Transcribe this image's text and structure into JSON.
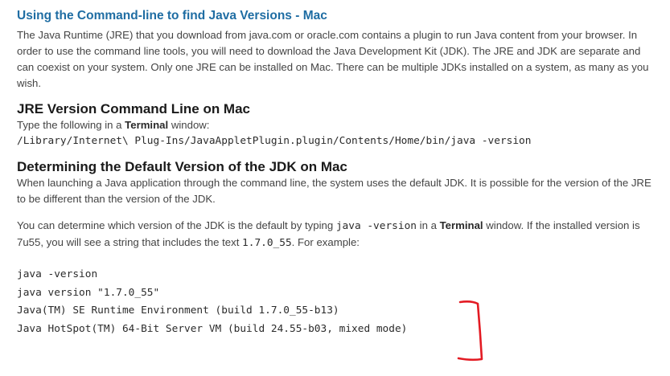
{
  "section": {
    "title": "Using the Command-line to find Java Versions - Mac",
    "intro": "The Java Runtime (JRE) that you download from java.com or oracle.com contains a plugin to run Java content from your browser. In order to use the command line tools, you will need to download the Java Development Kit (JDK). The JRE and JDK are separate and can coexist on your system. Only one JRE can be installed on Mac. There can be multiple JDKs installed on a system, as many as you wish."
  },
  "jre": {
    "heading": "JRE Version Command Line on Mac",
    "type_prefix": "Type the following in a ",
    "terminal_word": "Terminal",
    "type_suffix": " window:",
    "command": "/Library/Internet\\ Plug-Ins/JavaAppletPlugin.plugin/Contents/Home/bin/java -version"
  },
  "jdk": {
    "heading": "Determining the Default Version of the JDK on Mac",
    "para1": "When launching a Java application through the command line, the system uses the default JDK. It is possible for the version of the JRE to be different than the version of the JDK.",
    "para2_part1": "You can determine which version of the JDK is the default by typing ",
    "para2_code1": "java -version",
    "para2_part2": " in a ",
    "para2_terminal": "Terminal",
    "para2_part3": " window. If the installed version is 7u55, you will see a string that includes the text ",
    "para2_code2": "1.7.0_55",
    "para2_part4": ". For example:",
    "code_lines": [
      "java -version",
      "java version \"1.7.0_55\"",
      "Java(TM) SE Runtime Environment (build 1.7.0_55-b13)",
      "Java HotSpot(TM) 64-Bit Server VM (build 24.55-b03, mixed mode)"
    ]
  },
  "annotation": {
    "color": "#e31b23"
  }
}
